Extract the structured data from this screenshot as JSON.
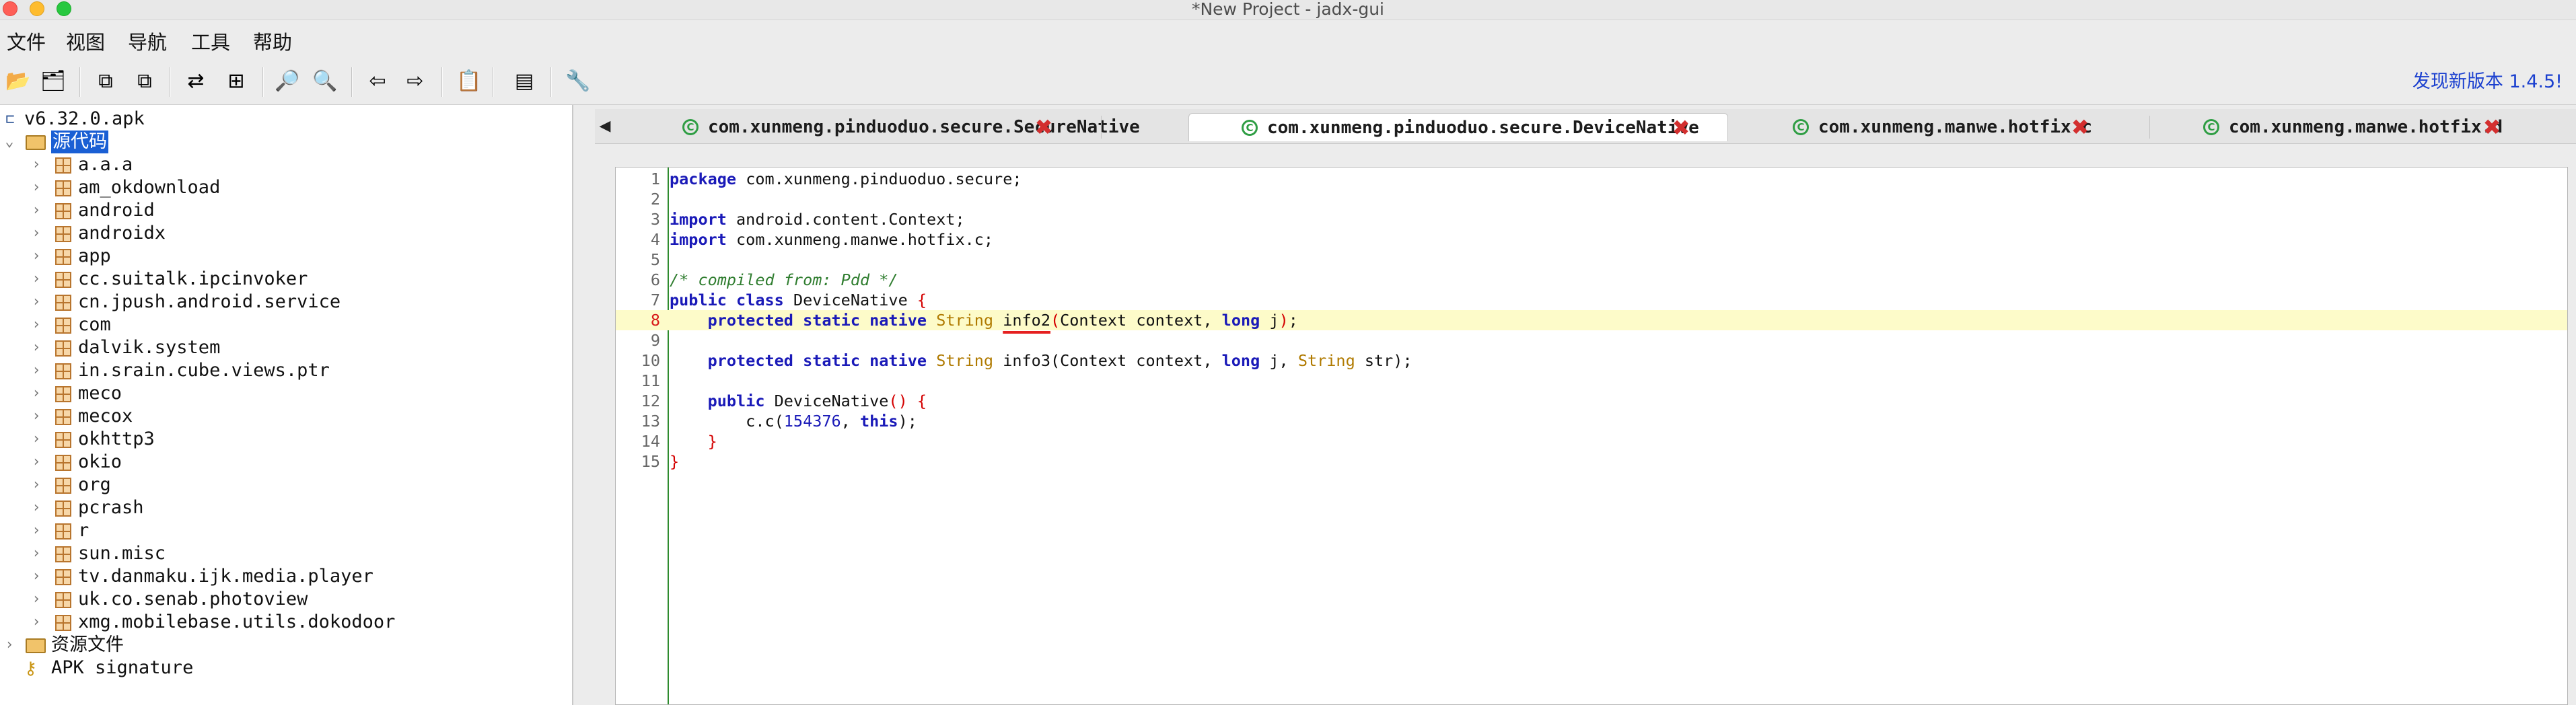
{
  "window": {
    "title": "*New Project - jadx-gui"
  },
  "menu": {
    "items": [
      "文件",
      "视图",
      "导航",
      "工具",
      "帮助"
    ]
  },
  "toolbar": {
    "buttons": [
      {
        "name": "open-file-icon",
        "glyph": "📂"
      },
      {
        "name": "add-files-icon",
        "glyph": "🗂"
      },
      {
        "name": "save-all-icon",
        "glyph": "⧉"
      },
      {
        "name": "export-icon",
        "glyph": "⧉"
      },
      {
        "name": "sync-tree-icon",
        "glyph": "⇄"
      },
      {
        "name": "flatten-packages-icon",
        "glyph": "⊞"
      },
      {
        "name": "search-text-icon",
        "glyph": "🔎"
      },
      {
        "name": "find-class-icon",
        "glyph": "🔍"
      },
      {
        "name": "back-icon",
        "glyph": "⇦"
      },
      {
        "name": "forward-icon",
        "glyph": "⇨"
      },
      {
        "name": "decompile-all-icon",
        "glyph": "📋"
      },
      {
        "name": "log-viewer-icon",
        "glyph": "▤"
      },
      {
        "name": "preferences-icon",
        "glyph": "🔧"
      }
    ],
    "update_notice": "发现新版本 1.4.5!"
  },
  "tree": {
    "root": "v6.32.0.apk",
    "source_folder": "源代码",
    "packages": [
      "a.a.a",
      "am_okdownload",
      "android",
      "androidx",
      "app",
      "cc.suitalk.ipcinvoker",
      "cn.jpush.android.service",
      "com",
      "dalvik.system",
      "in.srain.cube.views.ptr",
      "meco",
      "mecox",
      "okhttp3",
      "okio",
      "org",
      "pcrash",
      "r",
      "sun.misc",
      "tv.danmaku.ijk.media.player",
      "uk.co.senab.photoview",
      "xmg.mobilebase.utils.dokodoor"
    ],
    "resources_folder": "资源文件",
    "signature": "APK signature"
  },
  "tabs": [
    {
      "label": "com.xunmeng.pinduoduo.secure.SecureNative",
      "active": false
    },
    {
      "label": "com.xunmeng.pinduoduo.secure.DeviceNative",
      "active": true
    },
    {
      "label": "com.xunmeng.manwe.hotfix.c",
      "active": false
    },
    {
      "label": "com.xunmeng.manwe.hotfix.d",
      "active": false
    }
  ],
  "tab_scroll_glyph": "◀",
  "tab_close_glyph": "✖",
  "code": {
    "highlight_line": 8,
    "lines": [
      {
        "n": "1",
        "parts": [
          [
            "kw",
            "package"
          ],
          [
            "txt",
            " com.xunmeng.pinduoduo.secure;"
          ]
        ]
      },
      {
        "n": "2",
        "parts": []
      },
      {
        "n": "3",
        "parts": [
          [
            "kw",
            "import"
          ],
          [
            "txt",
            " android.content.Context;"
          ]
        ]
      },
      {
        "n": "4",
        "parts": [
          [
            "kw",
            "import"
          ],
          [
            "txt",
            " com.xunmeng.manwe.hotfix.c;"
          ]
        ]
      },
      {
        "n": "5",
        "parts": []
      },
      {
        "n": "6",
        "parts": [
          [
            "cmt",
            "/* compiled from: Pdd */"
          ]
        ]
      },
      {
        "n": "7",
        "parts": [
          [
            "kw",
            "public"
          ],
          [
            "txt",
            " "
          ],
          [
            "kw",
            "class"
          ],
          [
            "txt",
            " DeviceNative "
          ],
          [
            "brace",
            "{"
          ]
        ]
      },
      {
        "n": "8",
        "parts": [
          [
            "txt",
            "    "
          ],
          [
            "kw",
            "protected"
          ],
          [
            "txt",
            " "
          ],
          [
            "kw",
            "static"
          ],
          [
            "txt",
            " "
          ],
          [
            "kw",
            "native"
          ],
          [
            "txt",
            " "
          ],
          [
            "type",
            "String"
          ],
          [
            "txt",
            " "
          ],
          [
            "ul",
            "info2"
          ],
          [
            "brace",
            "("
          ],
          [
            "txt",
            "Context context, "
          ],
          [
            "kw",
            "long"
          ],
          [
            "txt",
            " j"
          ],
          [
            "brace",
            ")"
          ],
          [
            "txt",
            ";"
          ]
        ]
      },
      {
        "n": "9",
        "parts": []
      },
      {
        "n": "10",
        "parts": [
          [
            "txt",
            "    "
          ],
          [
            "kw",
            "protected"
          ],
          [
            "txt",
            " "
          ],
          [
            "kw",
            "static"
          ],
          [
            "txt",
            " "
          ],
          [
            "kw",
            "native"
          ],
          [
            "txt",
            " "
          ],
          [
            "type",
            "String"
          ],
          [
            "txt",
            " info3(Context context, "
          ],
          [
            "kw",
            "long"
          ],
          [
            "txt",
            " j, "
          ],
          [
            "type",
            "String"
          ],
          [
            "txt",
            " str);"
          ]
        ]
      },
      {
        "n": "11",
        "parts": []
      },
      {
        "n": "12",
        "parts": [
          [
            "txt",
            "    "
          ],
          [
            "kw",
            "public"
          ],
          [
            "txt",
            " DeviceNative"
          ],
          [
            "brace",
            "() {"
          ]
        ]
      },
      {
        "n": "13",
        "parts": [
          [
            "txt",
            "        c.c("
          ],
          [
            "num",
            "154376"
          ],
          [
            "txt",
            ", "
          ],
          [
            "kw",
            "this"
          ],
          [
            "txt",
            ");"
          ]
        ]
      },
      {
        "n": "14",
        "parts": [
          [
            "txt",
            "    "
          ],
          [
            "brace",
            "}"
          ]
        ]
      },
      {
        "n": "15",
        "parts": [
          [
            "brace",
            "}"
          ]
        ]
      }
    ]
  }
}
